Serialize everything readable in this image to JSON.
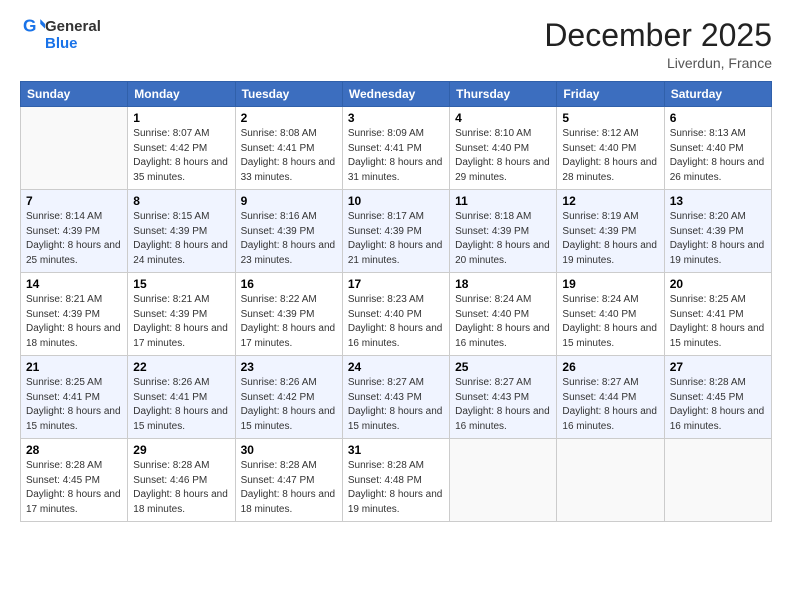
{
  "header": {
    "logo_general": "General",
    "logo_blue": "Blue",
    "month_title": "December 2025",
    "location": "Liverdun, France"
  },
  "days_of_week": [
    "Sunday",
    "Monday",
    "Tuesday",
    "Wednesday",
    "Thursday",
    "Friday",
    "Saturday"
  ],
  "weeks": [
    [
      {
        "day": "",
        "sunrise": "",
        "sunset": "",
        "daylight": ""
      },
      {
        "day": "1",
        "sunrise": "Sunrise: 8:07 AM",
        "sunset": "Sunset: 4:42 PM",
        "daylight": "Daylight: 8 hours and 35 minutes."
      },
      {
        "day": "2",
        "sunrise": "Sunrise: 8:08 AM",
        "sunset": "Sunset: 4:41 PM",
        "daylight": "Daylight: 8 hours and 33 minutes."
      },
      {
        "day": "3",
        "sunrise": "Sunrise: 8:09 AM",
        "sunset": "Sunset: 4:41 PM",
        "daylight": "Daylight: 8 hours and 31 minutes."
      },
      {
        "day": "4",
        "sunrise": "Sunrise: 8:10 AM",
        "sunset": "Sunset: 4:40 PM",
        "daylight": "Daylight: 8 hours and 29 minutes."
      },
      {
        "day": "5",
        "sunrise": "Sunrise: 8:12 AM",
        "sunset": "Sunset: 4:40 PM",
        "daylight": "Daylight: 8 hours and 28 minutes."
      },
      {
        "day": "6",
        "sunrise": "Sunrise: 8:13 AM",
        "sunset": "Sunset: 4:40 PM",
        "daylight": "Daylight: 8 hours and 26 minutes."
      }
    ],
    [
      {
        "day": "7",
        "sunrise": "Sunrise: 8:14 AM",
        "sunset": "Sunset: 4:39 PM",
        "daylight": "Daylight: 8 hours and 25 minutes."
      },
      {
        "day": "8",
        "sunrise": "Sunrise: 8:15 AM",
        "sunset": "Sunset: 4:39 PM",
        "daylight": "Daylight: 8 hours and 24 minutes."
      },
      {
        "day": "9",
        "sunrise": "Sunrise: 8:16 AM",
        "sunset": "Sunset: 4:39 PM",
        "daylight": "Daylight: 8 hours and 23 minutes."
      },
      {
        "day": "10",
        "sunrise": "Sunrise: 8:17 AM",
        "sunset": "Sunset: 4:39 PM",
        "daylight": "Daylight: 8 hours and 21 minutes."
      },
      {
        "day": "11",
        "sunrise": "Sunrise: 8:18 AM",
        "sunset": "Sunset: 4:39 PM",
        "daylight": "Daylight: 8 hours and 20 minutes."
      },
      {
        "day": "12",
        "sunrise": "Sunrise: 8:19 AM",
        "sunset": "Sunset: 4:39 PM",
        "daylight": "Daylight: 8 hours and 19 minutes."
      },
      {
        "day": "13",
        "sunrise": "Sunrise: 8:20 AM",
        "sunset": "Sunset: 4:39 PM",
        "daylight": "Daylight: 8 hours and 19 minutes."
      }
    ],
    [
      {
        "day": "14",
        "sunrise": "Sunrise: 8:21 AM",
        "sunset": "Sunset: 4:39 PM",
        "daylight": "Daylight: 8 hours and 18 minutes."
      },
      {
        "day": "15",
        "sunrise": "Sunrise: 8:21 AM",
        "sunset": "Sunset: 4:39 PM",
        "daylight": "Daylight: 8 hours and 17 minutes."
      },
      {
        "day": "16",
        "sunrise": "Sunrise: 8:22 AM",
        "sunset": "Sunset: 4:39 PM",
        "daylight": "Daylight: 8 hours and 17 minutes."
      },
      {
        "day": "17",
        "sunrise": "Sunrise: 8:23 AM",
        "sunset": "Sunset: 4:40 PM",
        "daylight": "Daylight: 8 hours and 16 minutes."
      },
      {
        "day": "18",
        "sunrise": "Sunrise: 8:24 AM",
        "sunset": "Sunset: 4:40 PM",
        "daylight": "Daylight: 8 hours and 16 minutes."
      },
      {
        "day": "19",
        "sunrise": "Sunrise: 8:24 AM",
        "sunset": "Sunset: 4:40 PM",
        "daylight": "Daylight: 8 hours and 15 minutes."
      },
      {
        "day": "20",
        "sunrise": "Sunrise: 8:25 AM",
        "sunset": "Sunset: 4:41 PM",
        "daylight": "Daylight: 8 hours and 15 minutes."
      }
    ],
    [
      {
        "day": "21",
        "sunrise": "Sunrise: 8:25 AM",
        "sunset": "Sunset: 4:41 PM",
        "daylight": "Daylight: 8 hours and 15 minutes."
      },
      {
        "day": "22",
        "sunrise": "Sunrise: 8:26 AM",
        "sunset": "Sunset: 4:41 PM",
        "daylight": "Daylight: 8 hours and 15 minutes."
      },
      {
        "day": "23",
        "sunrise": "Sunrise: 8:26 AM",
        "sunset": "Sunset: 4:42 PM",
        "daylight": "Daylight: 8 hours and 15 minutes."
      },
      {
        "day": "24",
        "sunrise": "Sunrise: 8:27 AM",
        "sunset": "Sunset: 4:43 PM",
        "daylight": "Daylight: 8 hours and 15 minutes."
      },
      {
        "day": "25",
        "sunrise": "Sunrise: 8:27 AM",
        "sunset": "Sunset: 4:43 PM",
        "daylight": "Daylight: 8 hours and 16 minutes."
      },
      {
        "day": "26",
        "sunrise": "Sunrise: 8:27 AM",
        "sunset": "Sunset: 4:44 PM",
        "daylight": "Daylight: 8 hours and 16 minutes."
      },
      {
        "day": "27",
        "sunrise": "Sunrise: 8:28 AM",
        "sunset": "Sunset: 4:45 PM",
        "daylight": "Daylight: 8 hours and 16 minutes."
      }
    ],
    [
      {
        "day": "28",
        "sunrise": "Sunrise: 8:28 AM",
        "sunset": "Sunset: 4:45 PM",
        "daylight": "Daylight: 8 hours and 17 minutes."
      },
      {
        "day": "29",
        "sunrise": "Sunrise: 8:28 AM",
        "sunset": "Sunset: 4:46 PM",
        "daylight": "Daylight: 8 hours and 18 minutes."
      },
      {
        "day": "30",
        "sunrise": "Sunrise: 8:28 AM",
        "sunset": "Sunset: 4:47 PM",
        "daylight": "Daylight: 8 hours and 18 minutes."
      },
      {
        "day": "31",
        "sunrise": "Sunrise: 8:28 AM",
        "sunset": "Sunset: 4:48 PM",
        "daylight": "Daylight: 8 hours and 19 minutes."
      },
      {
        "day": "",
        "sunrise": "",
        "sunset": "",
        "daylight": ""
      },
      {
        "day": "",
        "sunrise": "",
        "sunset": "",
        "daylight": ""
      },
      {
        "day": "",
        "sunrise": "",
        "sunset": "",
        "daylight": ""
      }
    ]
  ]
}
